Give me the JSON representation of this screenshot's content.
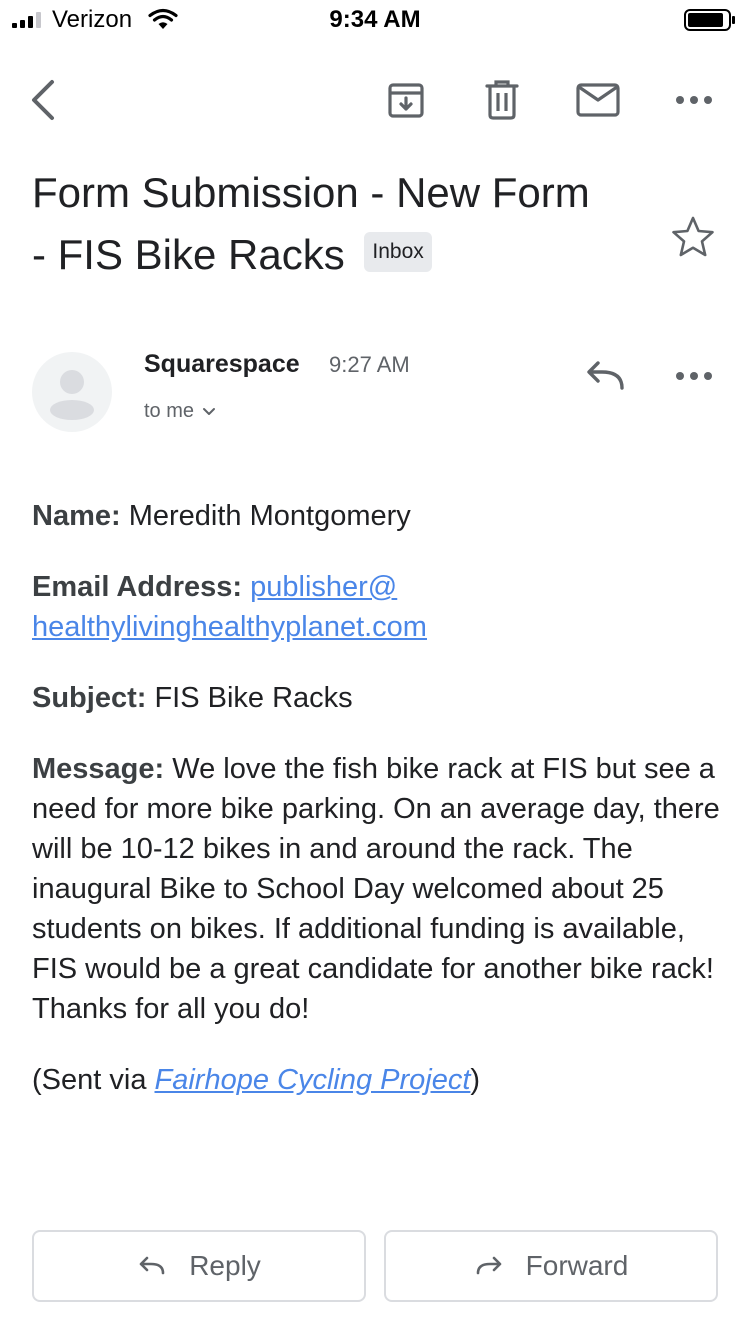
{
  "status_bar": {
    "carrier": "Verizon",
    "time": "9:34 AM",
    "signal_bars": 3,
    "battery_level": 0.85
  },
  "toolbar": {
    "back_icon": "chevron-left-icon",
    "archive_icon": "archive-icon",
    "delete_icon": "trash-icon",
    "mark_unread_icon": "mail-icon",
    "more_icon": "more-horizontal-icon"
  },
  "email": {
    "subject_line1": "Form Submission - New Form",
    "subject_line2": "- FIS Bike Racks",
    "label": "Inbox",
    "starred": false,
    "sender": {
      "name": "Squarespace",
      "time": "9:27 AM",
      "recipient": "to me"
    },
    "body": {
      "name_label": "Name:",
      "name_value": "Meredith Montgomery",
      "email_label": "Email Address:",
      "email_line1": "publisher@",
      "email_line2": "healthylivinghealthyplanet.com",
      "subject_label": "Subject:",
      "subject_value": "FIS Bike Racks",
      "message_label": "Message:",
      "message_value": "We love the fish bike rack at FIS but see a need for more bike parking. On an average day, there will be 10-12 bikes in and around the rack. The inaugural Bike to School Day welcomed about 25 students on bikes. If additional funding is available, FIS would be a great candidate for another bike rack! Thanks for all you do!",
      "sent_via_prefix": "(Sent via ",
      "sent_via_link": "Fairhope Cycling Project",
      "sent_via_suffix": ")"
    }
  },
  "actions": {
    "reply_label": "Reply",
    "forward_label": "Forward"
  },
  "colors": {
    "link": "#4a86e8",
    "icon": "#5f6368",
    "badge_bg": "#e8eaed"
  }
}
